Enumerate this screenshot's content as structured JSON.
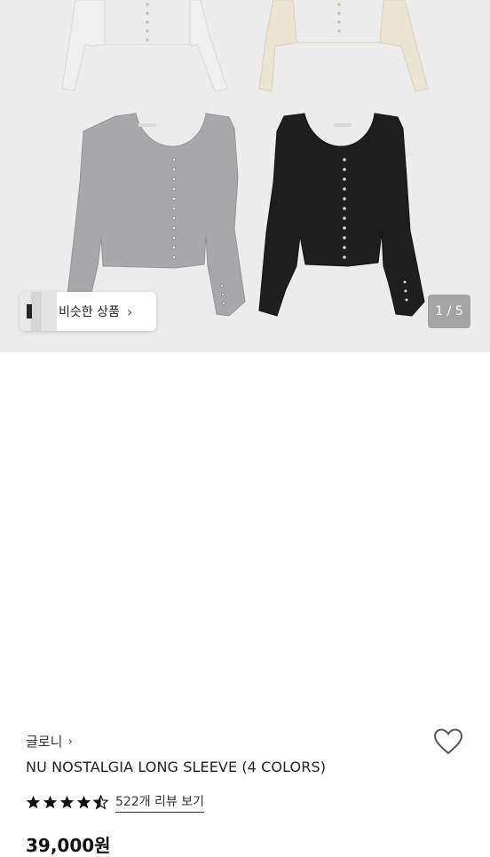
{
  "gallery": {
    "similar_button": {
      "label": "비슷한 상품",
      "arrow": "›",
      "thumbnail": "similar-products-thumbnail"
    },
    "pager": "1 / 5",
    "product_colors": [
      "#f0f0f0",
      "#efe9dc",
      "#a7a7a9",
      "#1e1e1e"
    ]
  },
  "product": {
    "brand": "글로니",
    "brand_arrow": "›",
    "name": "NU NOSTALGIA LONG SLEEVE (4 COLORS)",
    "rating": 4.5,
    "review_link": "522개 리뷰 보기",
    "price": "39,000원"
  },
  "icons": {
    "wishlist": "heart-icon",
    "rating": "star-icon"
  },
  "colors": {
    "gallery_bg": "#ececed",
    "text": "#222222",
    "star": "#111111"
  }
}
